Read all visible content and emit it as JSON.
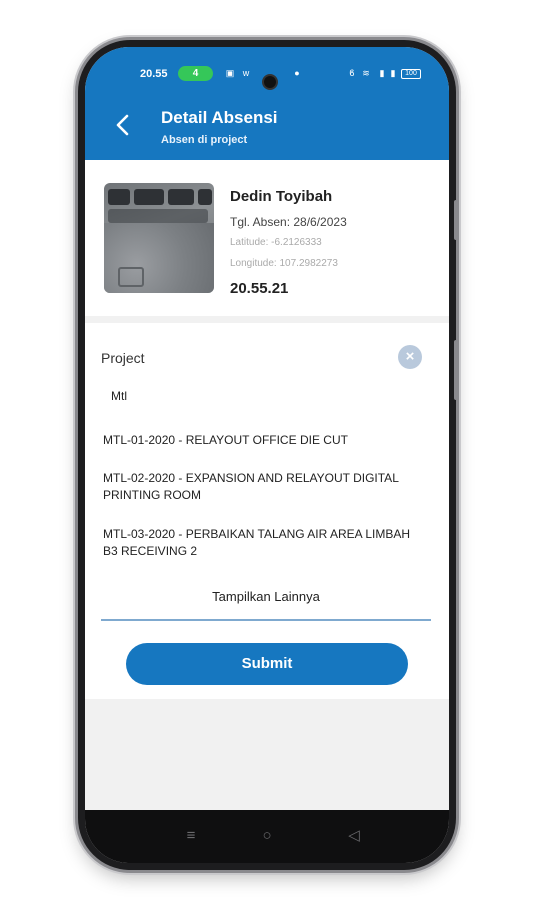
{
  "status_bar": {
    "time": "20.55",
    "badge": "4",
    "battery": "100"
  },
  "header": {
    "title": "Detail Absensi",
    "subtitle": "Absen di project"
  },
  "profile": {
    "name": "Dedin Toyibah",
    "date": "Tgl. Absen: 28/6/2023",
    "latitude": "Latitude: -6.2126333",
    "longitude": "Longitude: 107.2982273",
    "time": "20.55.21"
  },
  "project": {
    "label": "Project",
    "value": "Mtl",
    "options": [
      "MTL-01-2020 - RELAYOUT OFFICE DIE CUT",
      "MTL-02-2020 - EXPANSION AND RELAYOUT DIGITAL PRINTING ROOM",
      "MTL-03-2020 - PERBAIKAN TALANG AIR AREA LIMBAH B3 RECEIVING 2"
    ],
    "show_more": "Tampilkan Lainnya",
    "clear_icon": "close-icon"
  },
  "actions": {
    "submit_label": "Submit"
  },
  "nav": {
    "menu_icon": "≡",
    "home_icon": "○",
    "back_icon": "◁"
  },
  "colors": {
    "primary": "#1677c0",
    "clear_button": "#b9c9dc"
  }
}
